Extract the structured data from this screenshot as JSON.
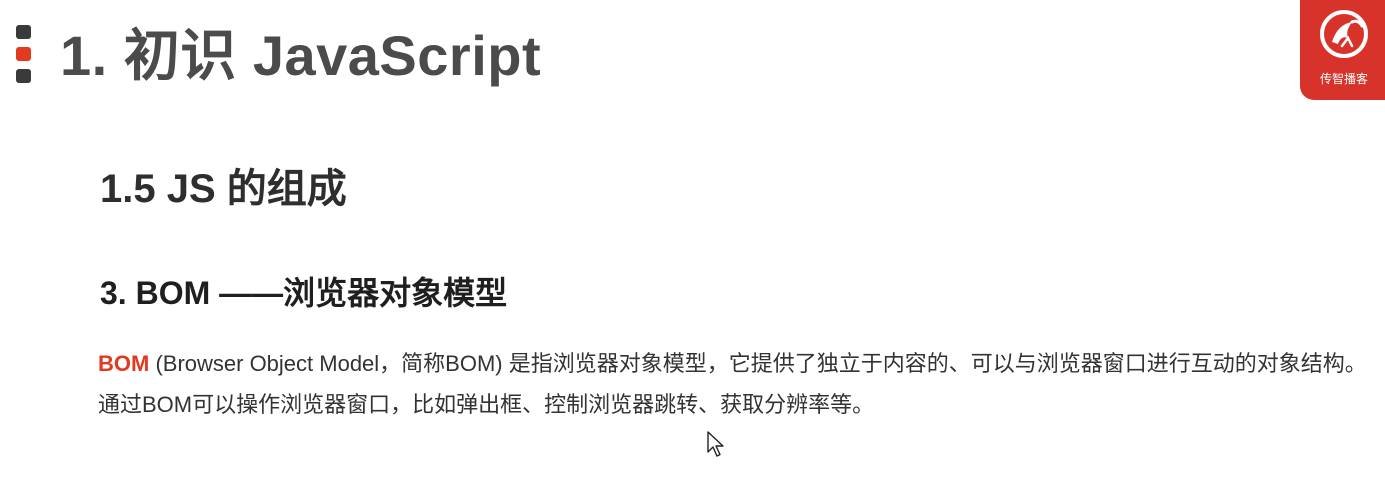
{
  "colors": {
    "accent_red": "#e23a1f",
    "marker_dark": "#3a3a3a",
    "logo_bg": "#d8332a"
  },
  "slide": {
    "title": "1. 初识 JavaScript",
    "section": "1.5 JS 的组成",
    "subsection": "3. BOM ——浏览器对象模型",
    "paragraph": {
      "keyword": "BOM",
      "text": " (Browser Object Model，简称BOM) 是指浏览器对象模型，它提供了独立于内容的、可以与浏览器窗口进行互动的对象结构。通过BOM可以操作浏览器窗口，比如弹出框、控制浏览器跳转、获取分辨率等。"
    }
  },
  "logo": {
    "text": "传智播客"
  },
  "icons": {
    "logo_emblem": "dragon-emblem-icon",
    "cursor": "mouse-pointer-icon"
  }
}
